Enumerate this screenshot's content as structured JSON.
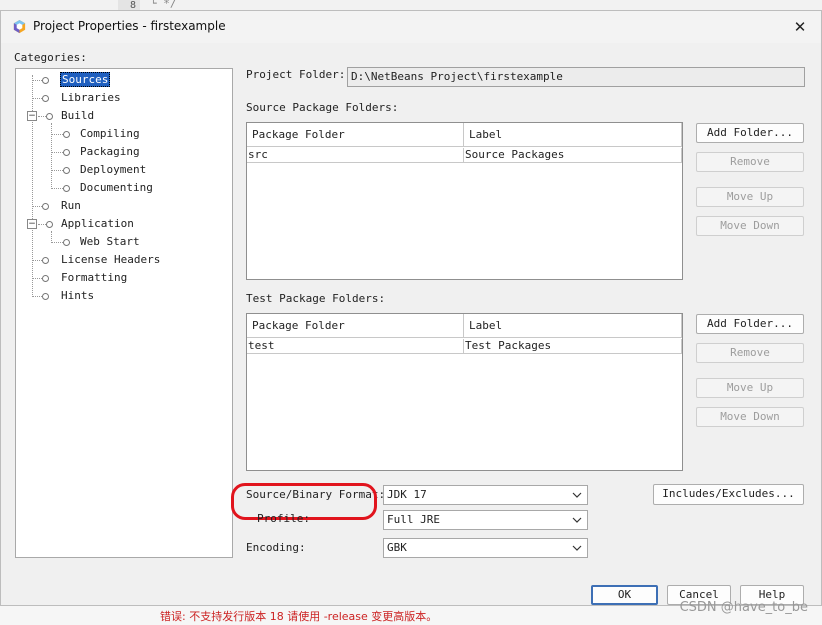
{
  "background": {
    "line_number": "8",
    "code_text": "└ */",
    "error_text": "错误: 不支持发行版本 18 请使用 -release 变更高版本。"
  },
  "watermark": "CSDN @have_to_be",
  "dialog": {
    "title": "Project Properties - firstexample",
    "close_glyph": "✕",
    "categories_label": "Categories:",
    "categories": [
      {
        "label": "Sources",
        "level": 0,
        "selected": true
      },
      {
        "label": "Libraries",
        "level": 0
      },
      {
        "label": "Build",
        "level": 0,
        "expanded": true
      },
      {
        "label": "Compiling",
        "level": 1
      },
      {
        "label": "Packaging",
        "level": 1
      },
      {
        "label": "Deployment",
        "level": 1
      },
      {
        "label": "Documenting",
        "level": 1
      },
      {
        "label": "Run",
        "level": 0
      },
      {
        "label": "Application",
        "level": 0,
        "expanded": true
      },
      {
        "label": "Web Start",
        "level": 1
      },
      {
        "label": "License Headers",
        "level": 0
      },
      {
        "label": "Formatting",
        "level": 0
      },
      {
        "label": "Hints",
        "level": 0
      }
    ],
    "project_folder_label": "Project Folder:",
    "project_folder_value": "D:\\NetBeans Project\\firstexample",
    "source_packages": {
      "section_label": "Source Package Folders:",
      "columns": [
        "Package Folder",
        "Label"
      ],
      "rows": [
        [
          "src",
          "Source Packages"
        ]
      ],
      "buttons": {
        "add": "Add Folder...",
        "remove": "Remove",
        "up": "Move Up",
        "down": "Move Down"
      }
    },
    "test_packages": {
      "section_label": "Test Package Folders:",
      "columns": [
        "Package Folder",
        "Label"
      ],
      "rows": [
        [
          "test",
          "Test Packages"
        ]
      ],
      "buttons": {
        "add": "Add Folder...",
        "remove": "Remove",
        "up": "Move Up",
        "down": "Move Down"
      }
    },
    "source_binary_format_label": "Source/Binary Format:",
    "source_binary_format_value": "JDK 17",
    "includes_excludes_label": "Includes/Excludes...",
    "profile_label": "Profile:",
    "profile_value": "Full JRE",
    "encoding_label": "Encoding:",
    "encoding_value": "GBK",
    "ok_label": "OK",
    "cancel_label": "Cancel",
    "help_label": "Help",
    "annotation_color": "#e1141d",
    "selection_color": "#1f5fbf"
  }
}
